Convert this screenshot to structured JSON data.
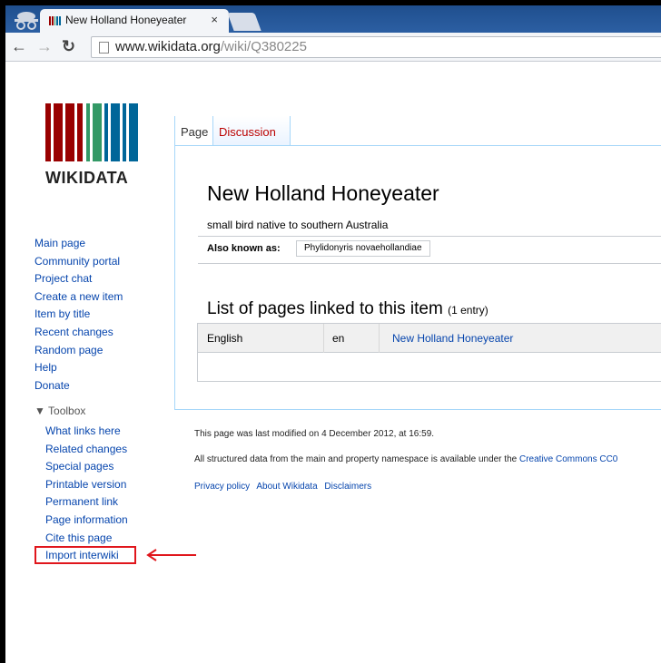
{
  "browser": {
    "tab_title": "New Holland Honeyeater",
    "tab_close": "×",
    "url_host": "www.wikidata.org",
    "url_path": "/wiki/Q380225"
  },
  "logo": {
    "text": "WIKIDATA"
  },
  "sidebar": {
    "items": [
      "Main page",
      "Community portal",
      "Project chat",
      "Create a new item",
      "Item by title",
      "Recent changes",
      "Random page",
      "Help",
      "Donate"
    ],
    "toolbox_label": "Toolbox",
    "toolbox_items": [
      "What links here",
      "Related changes",
      "Special pages",
      "Printable version",
      "Permanent link",
      "Page information",
      "Cite this page",
      "Import interwiki"
    ]
  },
  "page_tabs": {
    "page": "Page",
    "discussion": "Discussion"
  },
  "item": {
    "title": "New Holland Honeyeater",
    "description": "small bird native to southern Australia",
    "aka_label": "Also known as:",
    "aka_value": "Phylidonyris novaehollandiae"
  },
  "links_section": {
    "title": "List of pages linked to this item",
    "count": "(1 entry)",
    "rows": [
      {
        "language": "English",
        "code": "en",
        "page": "New Holland Honeyeater"
      }
    ]
  },
  "footer": {
    "modified": "This page was last modified on 4 December 2012, at 16:59.",
    "license_prefix": "All structured data from the main and property namespace is available under the",
    "license_link": "Creative Commons CC0",
    "links": [
      "Privacy policy",
      "About Wikidata",
      "Disclaimers"
    ]
  },
  "colors": {
    "link": "#0645ad",
    "highlight": "#e0161c",
    "tab_border": "#a7d7f9"
  }
}
